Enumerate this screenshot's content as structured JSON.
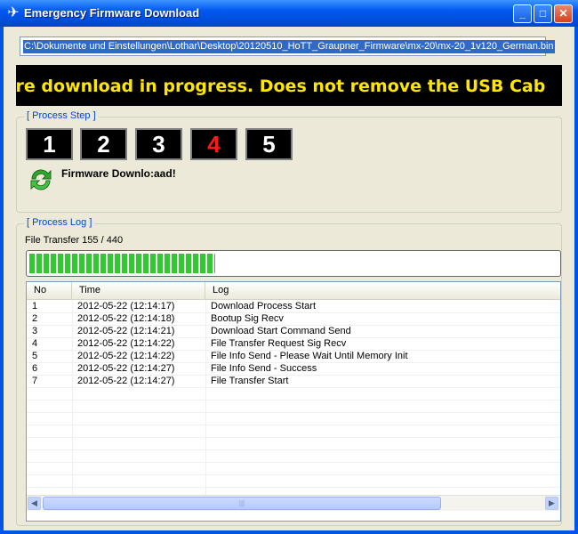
{
  "window": {
    "title": "Emergency Firmware Download",
    "controls": {
      "minimize": "_",
      "maximize": "□",
      "close": "✕"
    },
    "icon": "plane-icon"
  },
  "file_path": "C:\\Dokumente und Einstellungen\\Lothar\\Desktop\\20120510_HoTT_Graupner_Firmware\\mx-20\\mx-20_1v120_German.bin",
  "marquee": "rmware download in progress. Does not remove the USB Cab",
  "process_step": {
    "label": "[ Process Step ]",
    "steps": [
      "1",
      "2",
      "3",
      "4",
      "5"
    ],
    "active_step": "4",
    "status_text": "Firmware Downlo:aad!",
    "status_icon": "refresh-icon"
  },
  "process_log": {
    "label": "[ Process Log ]",
    "transfer_text": "File Transfer 155 / 440",
    "progress_fraction": 0.352,
    "columns": [
      "No",
      "Time",
      "Log"
    ],
    "rows": [
      {
        "no": "1",
        "time": "2012-05-22 (12:14:17)",
        "log": "Download Process Start"
      },
      {
        "no": "2",
        "time": "2012-05-22 (12:14:18)",
        "log": "Bootup Sig Recv"
      },
      {
        "no": "3",
        "time": "2012-05-22 (12:14:21)",
        "log": "Download Start Command Send"
      },
      {
        "no": "4",
        "time": "2012-05-22 (12:14:22)",
        "log": "File Transfer Request Sig Recv"
      },
      {
        "no": "5",
        "time": "2012-05-22 (12:14:22)",
        "log": "File Info Send - Please Wait Until Memory Init"
      },
      {
        "no": "6",
        "time": "2012-05-22 (12:14:27)",
        "log": "File Info Send - Success"
      },
      {
        "no": "7",
        "time": "2012-05-22 (12:14:27)",
        "log": "File Transfer Start"
      }
    ]
  },
  "scrollbar": {
    "left_arrow": "◀",
    "right_arrow": "▶",
    "grip": "|||"
  },
  "colors": {
    "accent": "#0058ee",
    "progress": "#32c832",
    "marquee_text": "#ffe600",
    "active_step": "#ff1a1a"
  }
}
